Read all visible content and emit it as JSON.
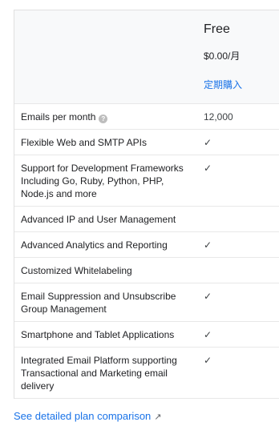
{
  "plan": {
    "name": "Free",
    "price": "$0.00/月",
    "cta": "定期購入"
  },
  "features": [
    {
      "label": "Emails per month",
      "value": "12,000",
      "help": true
    },
    {
      "label": "Flexible Web and SMTP APIs",
      "value": "✓"
    },
    {
      "label": "Support for Development Frameworks Including Go, Ruby, Python, PHP, Node.js and more",
      "value": "✓"
    },
    {
      "label": "Advanced IP and User Management",
      "value": ""
    },
    {
      "label": "Advanced Analytics and Reporting",
      "value": "✓"
    },
    {
      "label": "Customized Whitelabeling",
      "value": ""
    },
    {
      "label": "Email Suppression and Unsubscribe Group Management",
      "value": "✓"
    },
    {
      "label": "Smartphone and Tablet Applications",
      "value": "✓"
    },
    {
      "label": "Integrated Email Platform supporting Transactional and Marketing email delivery",
      "value": "✓"
    }
  ],
  "footer": {
    "link_label": "See detailed plan comparison",
    "link_icon": "external-link-icon"
  }
}
